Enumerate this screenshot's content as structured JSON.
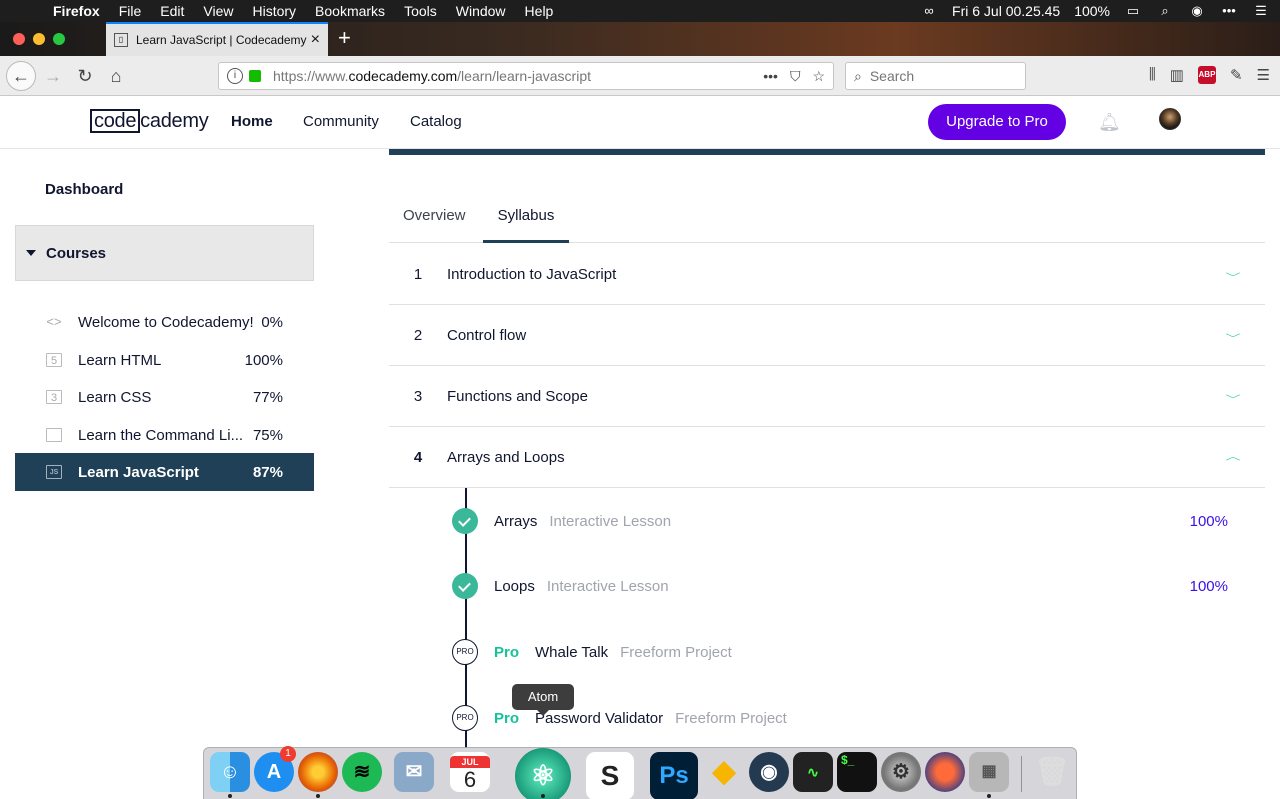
{
  "menubar": {
    "app_name": "Firefox",
    "items": [
      "File",
      "Edit",
      "View",
      "History",
      "Bookmarks",
      "Tools",
      "Window",
      "Help"
    ],
    "datetime": "Fri 6 Jul  00.25.45",
    "battery": "100%"
  },
  "browser": {
    "tab_title": "Learn JavaScript | Codecademy",
    "url_prefix": "https://www.",
    "url_domain": "codecademy.com",
    "url_path": "/learn/learn-javascript",
    "search_placeholder": "Search",
    "abp_label": "ABP"
  },
  "header": {
    "logo_boxed": "code",
    "logo_rest": "cademy",
    "nav": {
      "home": "Home",
      "community": "Community",
      "catalog": "Catalog"
    },
    "upgrade_label": "Upgrade to Pro"
  },
  "sidebar": {
    "dashboard": "Dashboard",
    "courses_label": "Courses",
    "courses": [
      {
        "name": "Welcome to Codecademy!",
        "percent": "0%",
        "icon": "code-icon"
      },
      {
        "name": "Learn HTML",
        "percent": "100%",
        "icon": "html-icon"
      },
      {
        "name": "Learn CSS",
        "percent": "77%",
        "icon": "css-icon"
      },
      {
        "name": "Learn the Command Li...",
        "percent": "75%",
        "icon": "terminal-icon"
      },
      {
        "name": "Learn JavaScript",
        "percent": "87%",
        "icon": "js-icon"
      }
    ]
  },
  "main": {
    "tabs": {
      "overview": "Overview",
      "syllabus": "Syllabus"
    },
    "modules": [
      {
        "num": "1",
        "title": "Introduction to JavaScript"
      },
      {
        "num": "2",
        "title": "Control flow"
      },
      {
        "num": "3",
        "title": "Functions and Scope"
      },
      {
        "num": "4",
        "title": "Arrays and Loops"
      }
    ],
    "lessons": [
      {
        "name": "Arrays",
        "type": "Interactive Lesson",
        "percent": "100%"
      },
      {
        "name": "Loops",
        "type": "Interactive Lesson",
        "percent": "100%"
      },
      {
        "pro": "Pro",
        "badge": "PRO",
        "name": "Whale Talk",
        "type": "Freeform Project"
      },
      {
        "pro": "Pro",
        "badge": "PRO",
        "name": "Password Validator",
        "type": "Freeform Project"
      }
    ]
  },
  "dock": {
    "tooltip": "Atom",
    "appstore_badge": "1",
    "calendar_month": "JUL",
    "calendar_day": "6"
  },
  "colors": {
    "accent_purple": "#6400e4",
    "navy": "#1f4056",
    "teal": "#15c39a",
    "percent_blue": "#3a10e5"
  }
}
